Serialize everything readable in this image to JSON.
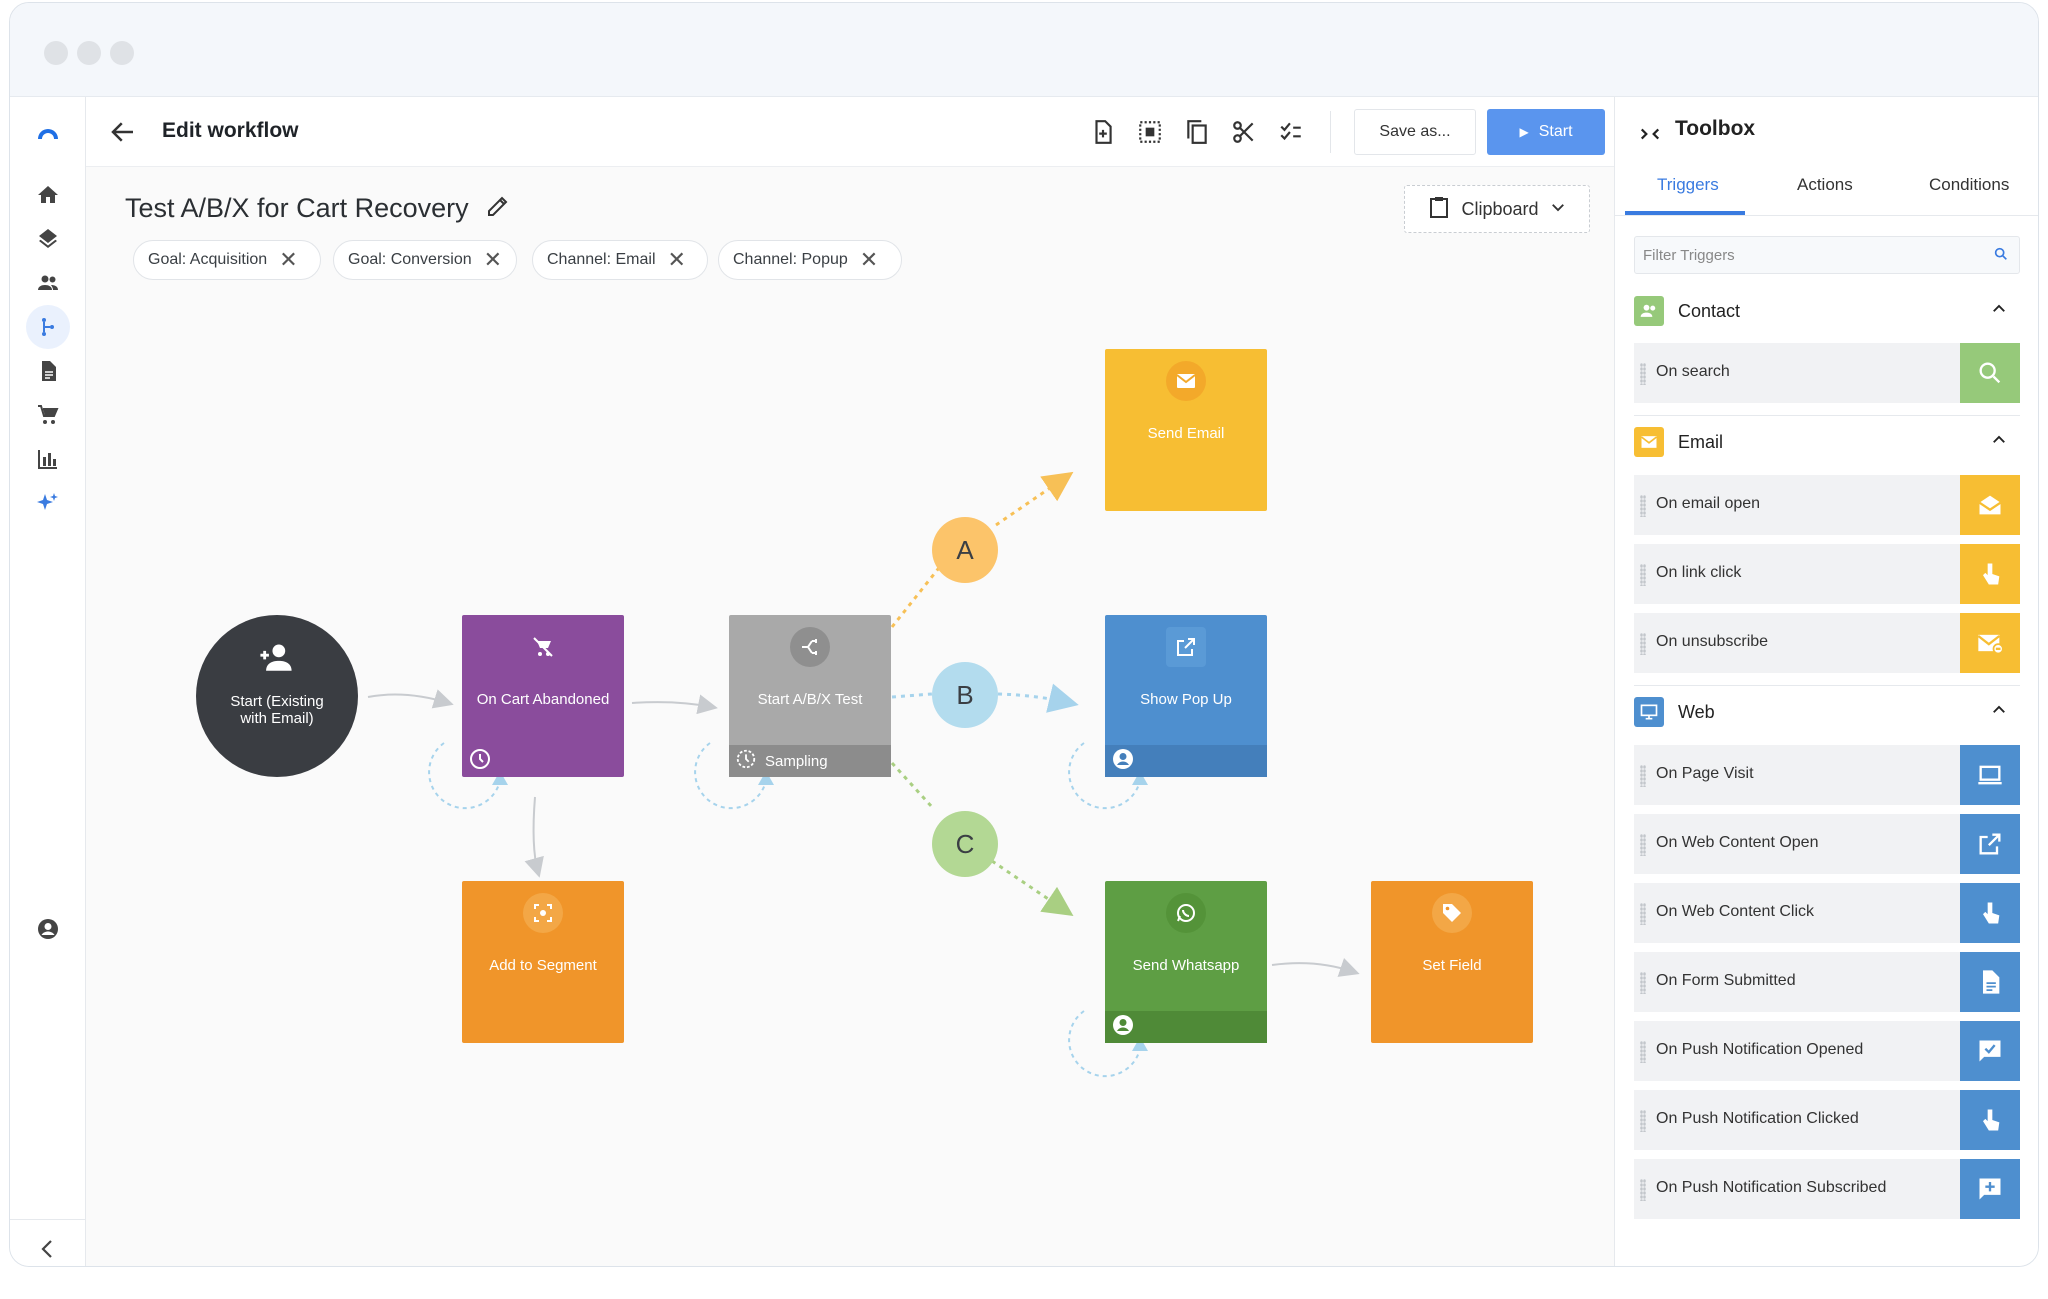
{
  "header": {
    "title": "Edit workflow",
    "save_as": "Save as...",
    "start": "Start"
  },
  "workflow": {
    "name": "Test A/B/X for Cart Recovery",
    "tags": [
      "Goal: Acquisition",
      "Goal: Conversion",
      "Channel: Email",
      "Channel: Popup"
    ],
    "clipboard": "Clipboard"
  },
  "nodes": {
    "start": "Start (Existing with Email)",
    "cart": "On Cart Abandoned",
    "ab": "Start A/B/X Test",
    "ab_footer": "Sampling",
    "segment": "Add to Segment",
    "email": "Send Email",
    "popup": "Show Pop Up",
    "whatsapp": "Send Whatsapp",
    "field": "Set Field"
  },
  "branches": [
    "A",
    "B",
    "C"
  ],
  "colors": {
    "purple": "#8a4c9c",
    "orange": "#f0952a",
    "yellow": "#f7be33",
    "blue": "#4e8fcf",
    "green": "#5e9e44",
    "gray": "#a9a9a9",
    "dark": "#3a3d42",
    "accent": "#5a95ee"
  },
  "toolbox": {
    "title": "Toolbox",
    "tabs": [
      "Triggers",
      "Actions",
      "Conditions"
    ],
    "active_tab": "Triggers",
    "filter_placeholder": "Filter Triggers",
    "sections": [
      {
        "title": "Contact",
        "items": [
          "On search"
        ]
      },
      {
        "title": "Email",
        "items": [
          "On email open",
          "On link click",
          "On unsubscribe"
        ]
      },
      {
        "title": "Web",
        "items": [
          "On Page Visit",
          "On Web Content Open",
          "On Web Content Click",
          "On Form Submitted",
          "On Push Notification Opened",
          "On Push Notification Clicked",
          "On Push Notification Subscribed"
        ]
      }
    ]
  },
  "nav": {
    "icons": [
      "home-icon",
      "layers-icon",
      "people-icon",
      "workflow-icon",
      "document-icon",
      "cart-icon",
      "chart-icon",
      "sparkle-icon",
      "account-icon",
      "collapse-icon"
    ]
  }
}
